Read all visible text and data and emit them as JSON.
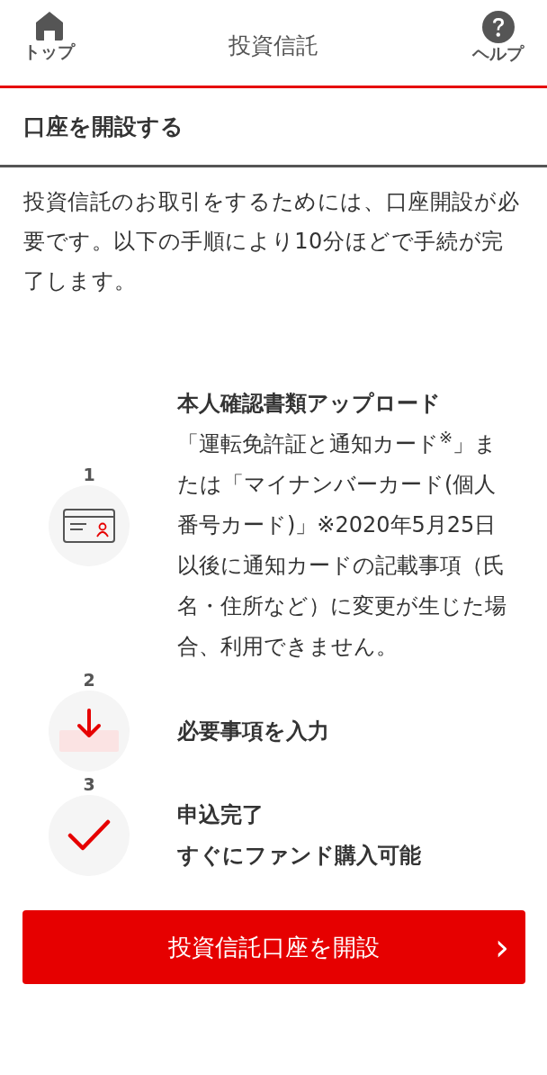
{
  "header": {
    "home_label": "トップ",
    "title": "投資信託",
    "help_label": "ヘルプ"
  },
  "section_title": "口座を開設する",
  "intro": "投資信託のお取引をするためには、口座開設が必要です。以下の手順により10分ほどで手続が完了します。",
  "steps": [
    {
      "number": "1",
      "kind": "id-card",
      "lines": [
        {
          "text": "本人確認書類アップロード",
          "bold": true
        },
        {
          "text": "「運転免許証と通知カード$^{※}$」または「マイナンバーカード(個人番号カード)」※2020年5月25日以後に通知カードの記載事項（氏名・住所など）に変更が生じた場合、利用できません。",
          "bold": false
        }
      ]
    },
    {
      "number": "2",
      "kind": "input",
      "lines": [
        {
          "text": "必要事項を入力",
          "bold": true
        }
      ]
    },
    {
      "number": "3",
      "kind": "check",
      "lines": [
        {
          "text": "申込完了",
          "bold": true
        },
        {
          "text": "すぐにファンド購入可能",
          "bold": true
        }
      ]
    }
  ],
  "button": {
    "label": "投資信託口座を開設",
    "arrow": "›"
  }
}
